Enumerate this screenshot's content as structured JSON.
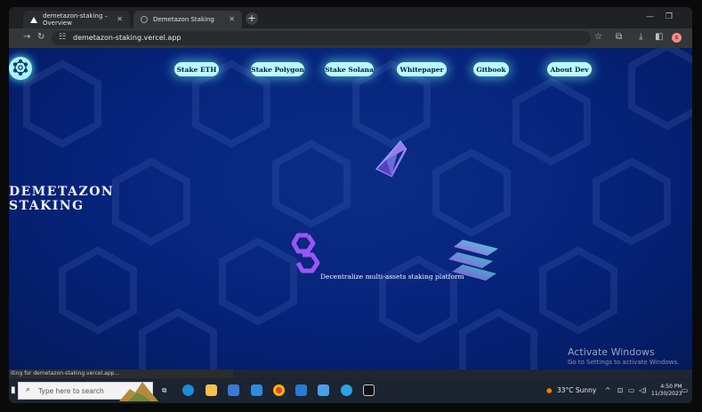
{
  "browser": {
    "tabs": [
      {
        "label": "demetazon-staking – Overview"
      },
      {
        "label": "Demetazon Staking"
      }
    ],
    "url": "demetazon-staking.vercel.app",
    "status_text": "iting for demetazon-staking.vercel.app..."
  },
  "nav": {
    "items": [
      {
        "label": "Stake ETH"
      },
      {
        "label": "Stake Polygon"
      },
      {
        "label": "Stake Solana"
      },
      {
        "label": "Whitepaper"
      },
      {
        "label": "Gitbook"
      },
      {
        "label": "About Dev"
      }
    ]
  },
  "hero": {
    "headline": "DEMETAZON\nSTAKING",
    "tagline": "Decentralize multi-assets staking platform"
  },
  "watermark": {
    "title": "Activate Windows",
    "subtitle": "Go to Settings to activate Windows."
  },
  "taskbar": {
    "search_placeholder": "Type here to search",
    "weather": "33°C  Sunny",
    "time": "4:50 PM",
    "date": "11/30/2023"
  },
  "colors": {
    "page_bg": "#06237a",
    "nav_pill": "#b9fbff",
    "glow": "#78ffff"
  }
}
